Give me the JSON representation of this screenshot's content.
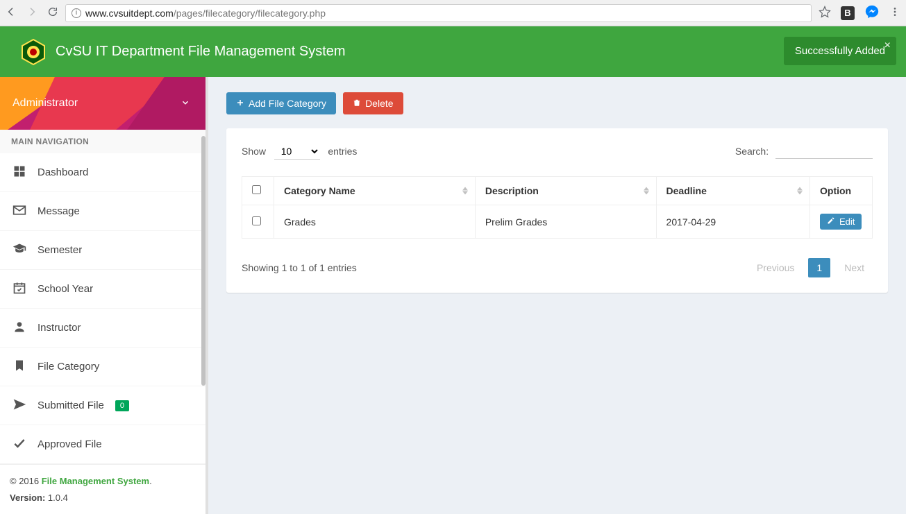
{
  "chrome": {
    "url_full": "www.cvsuitdept.com/pages/filecategory/filecategory.php",
    "url_host": "www.cvsuitdept.com",
    "url_path": "/pages/filecategory/filecategory.php",
    "ext_b": "B"
  },
  "header": {
    "title": "CvSU IT Department File Management System",
    "toast": "Successfully Added",
    "toast_close": "×"
  },
  "sidebar": {
    "user": "Administrator",
    "nav_header": "MAIN NAVIGATION",
    "items": [
      {
        "label": "Dashboard"
      },
      {
        "label": "Message"
      },
      {
        "label": "Semester"
      },
      {
        "label": "School Year"
      },
      {
        "label": "Instructor"
      },
      {
        "label": "File Category"
      },
      {
        "label": "Submitted File",
        "badge": "0"
      },
      {
        "label": "Approved File"
      }
    ],
    "footer_copy": "© 2016 ",
    "footer_link": "File Management System",
    "footer_dot": ".",
    "footer_version_label": "Version:",
    "footer_version": " 1.0.4"
  },
  "actions": {
    "add": "Add File Category",
    "delete": "Delete"
  },
  "table": {
    "show_label": "Show",
    "entries_label": "entries",
    "entries_value": "10",
    "search_label": "Search:",
    "columns": [
      "Category Name",
      "Description",
      "Deadline",
      "Option"
    ],
    "rows": [
      {
        "name": "Grades",
        "description": "Prelim Grades",
        "deadline": "2017-04-29"
      }
    ],
    "edit_label": "Edit",
    "info": "Showing 1 to 1 of 1 entries",
    "prev": "Previous",
    "page": "1",
    "next": "Next"
  }
}
